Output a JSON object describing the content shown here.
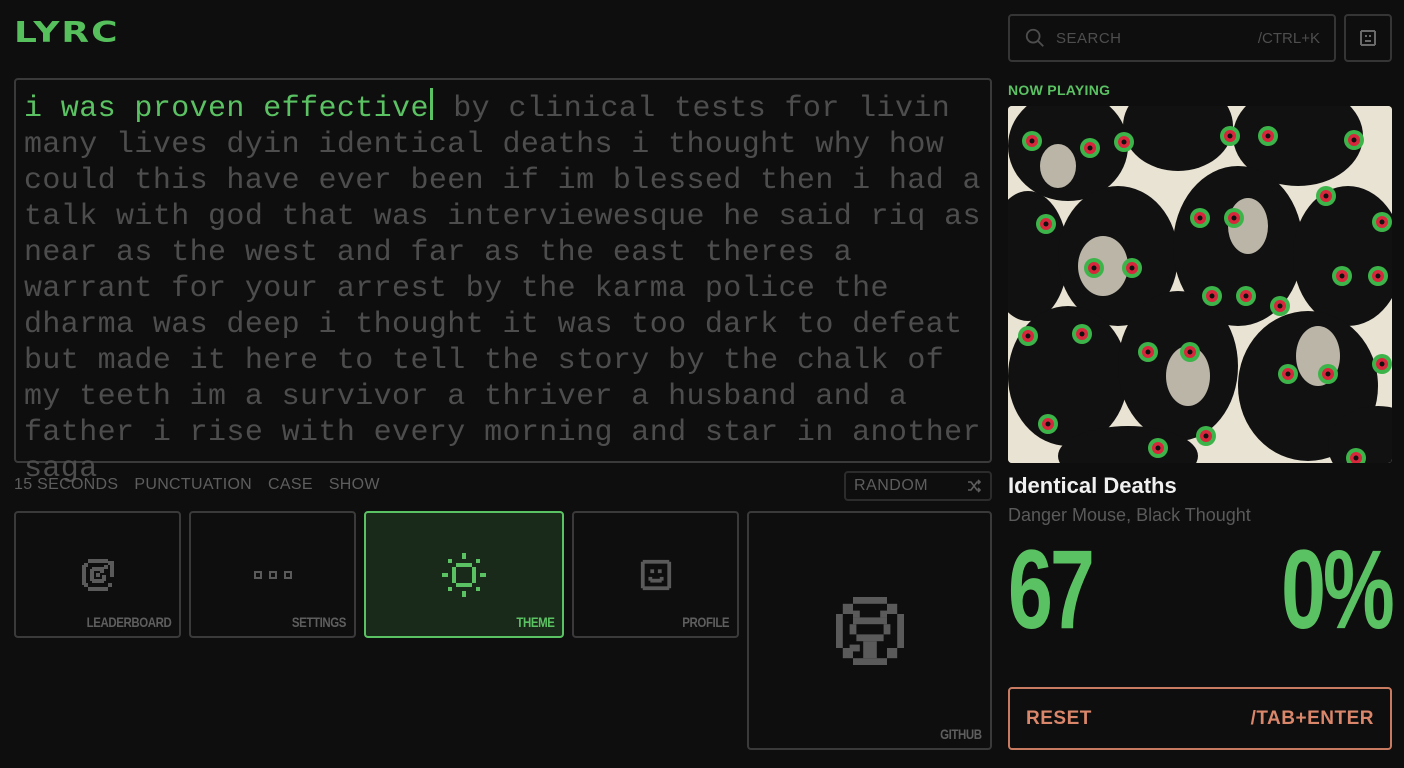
{
  "app": {
    "logo": "LYRC"
  },
  "search": {
    "placeholder": "SEARCH",
    "shortcut": "/CTRL+K"
  },
  "lyrics": {
    "typed": "i was proven effective",
    "remaining": " by clinical tests for livin many lives dyin identical deaths i thought why how could this have ever been if im blessed then i had a talk with god that was interviewesque he said riq as near as the west and far as the east theres a warrant for your arrest by the karma police the dharma was deep i thought it was too dark to defeat but made it here to tell the story by the chalk of my teeth im a survivor a thriver a husband and a father i rise with every morning and star in another saga"
  },
  "modes": [
    "15 SECONDS",
    "PUNCTUATION",
    "CASE",
    "SHOW"
  ],
  "random": {
    "label": "RANDOM",
    "icon": "shuffle-icon"
  },
  "tiles": [
    {
      "label": "LEADERBOARD",
      "icon": "target-icon",
      "active": false
    },
    {
      "label": "SETTINGS",
      "icon": "dots-icon",
      "active": false
    },
    {
      "label": "THEME",
      "icon": "sun-icon",
      "active": true
    },
    {
      "label": "PROFILE",
      "icon": "smile-icon",
      "active": false
    },
    {
      "label": "GITHUB",
      "icon": "github-icon",
      "active": false
    }
  ],
  "now_playing": {
    "label": "NOW PLAYING",
    "title": "Identical Deaths",
    "artist": "Danger Mouse, Black Thought"
  },
  "stats": {
    "wpm": "67",
    "accuracy": "0%"
  },
  "reset": {
    "label": "RESET",
    "shortcut": "/TAB+ENTER"
  },
  "colors": {
    "accent": "#5bc263",
    "reset": "#d9866a",
    "background": "#0e0e0e"
  }
}
